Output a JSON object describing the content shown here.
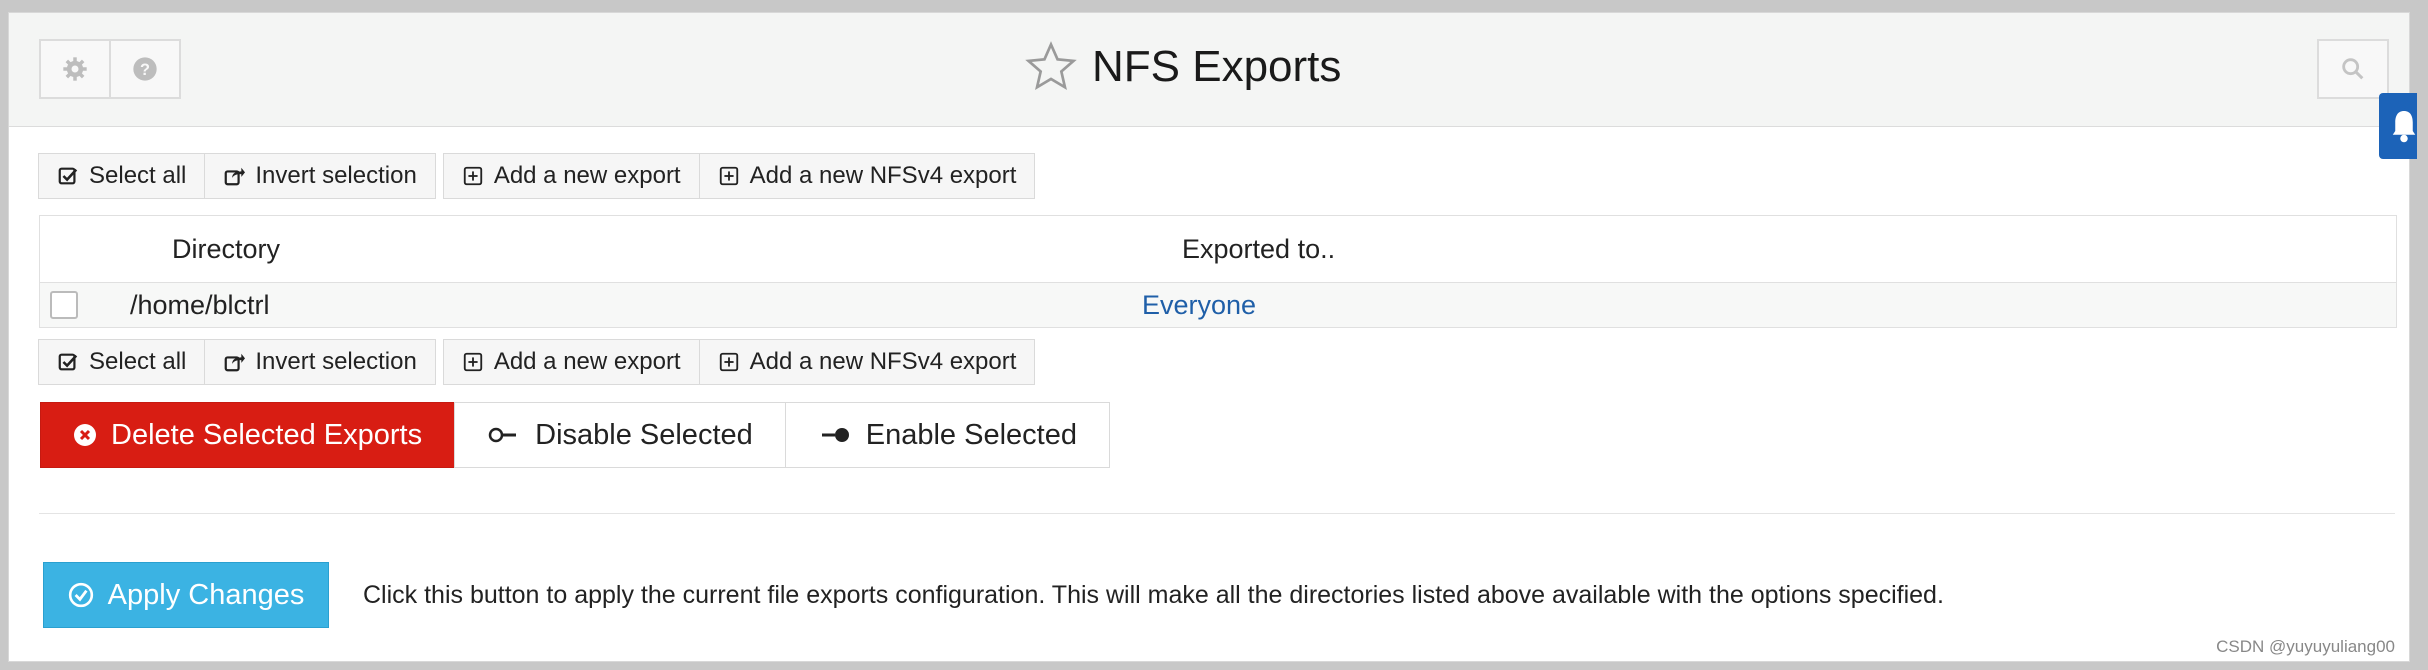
{
  "header": {
    "title": "NFS Exports",
    "icons": {
      "settings": "gear-icon",
      "help": "help-icon",
      "favorite": "star-icon",
      "search": "search-icon"
    }
  },
  "toolbar": {
    "select_all": "Select all",
    "invert_selection": "Invert selection",
    "add_export": "Add a new export",
    "add_nfsv4_export": "Add a new NFSv4 export"
  },
  "table": {
    "columns": [
      "Directory",
      "Exported to.."
    ],
    "rows": [
      {
        "directory": "/home/blctrl",
        "exported_to": "Everyone"
      }
    ]
  },
  "actions": {
    "delete": "Delete Selected Exports",
    "disable": "Disable Selected",
    "enable": "Enable Selected"
  },
  "apply": {
    "label": "Apply Changes",
    "description": "Click this button to apply the current file exports configuration. This will make all the directories listed above available with the options specified."
  },
  "watermark": "CSDN @yuyuyuliang00",
  "colors": {
    "danger": "#d81d13",
    "apply": "#3bb3e3",
    "link": "#1f5fa8",
    "accent": "#1c63b8"
  }
}
